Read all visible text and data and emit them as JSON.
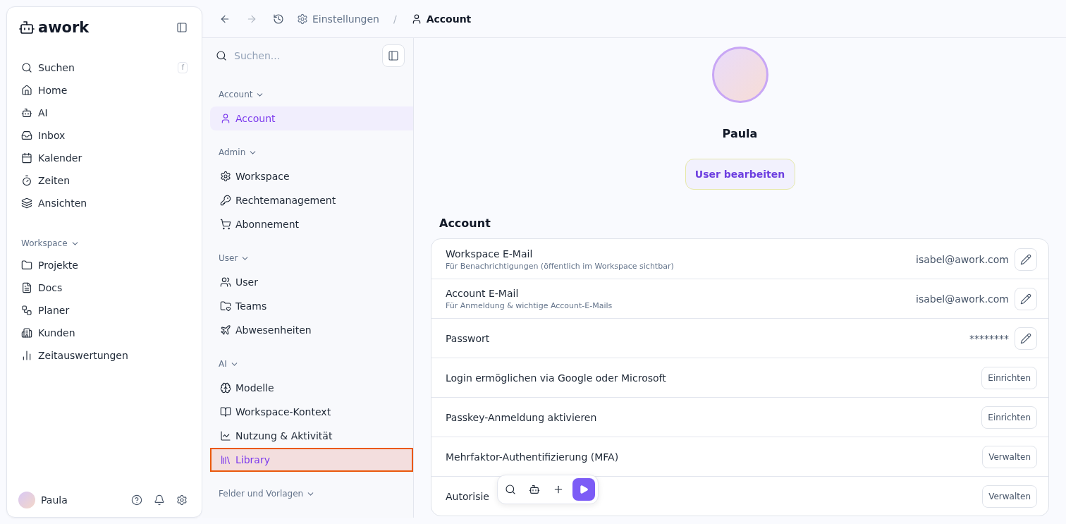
{
  "sidebar": {
    "logo": "awork",
    "search": {
      "label": "Suchen",
      "shortcut": "f"
    },
    "items": [
      {
        "label": "Home"
      },
      {
        "label": "AI"
      },
      {
        "label": "Inbox"
      },
      {
        "label": "Kalender"
      },
      {
        "label": "Zeiten"
      },
      {
        "label": "Ansichten"
      }
    ],
    "workspace": {
      "title": "Workspace",
      "expanded": true,
      "items": [
        {
          "label": "Projekte"
        },
        {
          "label": "Docs"
        },
        {
          "label": "Planer"
        },
        {
          "label": "Kunden"
        },
        {
          "label": "Zeitauswertungen"
        }
      ]
    },
    "user": {
      "name": "Paula"
    }
  },
  "breadcrumb_separator": "/",
  "breadcrumb": [
    {
      "label": "Einstellungen",
      "current": false
    },
    {
      "label": "Account",
      "current": true
    }
  ],
  "settings_nav": {
    "search": {
      "placeholder": "Suchen..."
    },
    "groups": [
      {
        "title": "Account",
        "items": [
          {
            "label": "Account",
            "selected": true,
            "highlighted": false
          }
        ]
      },
      {
        "title": "Admin",
        "items": [
          {
            "label": "Workspace",
            "selected": false,
            "highlighted": false
          },
          {
            "label": "Rechtemanagement",
            "selected": false,
            "highlighted": false
          },
          {
            "label": "Abonnement",
            "selected": false,
            "highlighted": false
          }
        ]
      },
      {
        "title": "User",
        "items": [
          {
            "label": "User",
            "selected": false,
            "highlighted": false
          },
          {
            "label": "Teams",
            "selected": false,
            "highlighted": false
          },
          {
            "label": "Abwesenheiten",
            "selected": false,
            "highlighted": false
          }
        ]
      },
      {
        "title": "AI",
        "items": [
          {
            "label": "Modelle",
            "selected": false,
            "highlighted": false
          },
          {
            "label": "Workspace-Kontext",
            "selected": false,
            "highlighted": false
          },
          {
            "label": "Nutzung & Aktivität",
            "selected": false,
            "highlighted": false
          },
          {
            "label": "Library",
            "selected": false,
            "highlighted": true
          }
        ]
      },
      {
        "title": "Felder und Vorlagen"
      }
    ]
  },
  "profile": {
    "name": "Paula",
    "edit_button": "User bearbeiten"
  },
  "account": {
    "title": "Account",
    "rows": [
      {
        "kind": "edit",
        "label": "Workspace E-Mail",
        "description": "Für Benachrichtigungen (öffentlich im Workspace sichtbar)",
        "value": "isabel@awork.com"
      },
      {
        "kind": "edit",
        "label": "Account E-Mail",
        "description": "Für Anmeldung & wichtige Account-E-Mails",
        "value": "isabel@awork.com"
      },
      {
        "kind": "edit",
        "label": "Passwort",
        "value": "********"
      },
      {
        "kind": "action",
        "label": "Login ermöglichen via Google oder Microsoft",
        "button": "Einrichten"
      },
      {
        "kind": "action",
        "label": "Passkey-Anmeldung aktivieren",
        "button": "Einrichten"
      },
      {
        "kind": "action",
        "label": "Mehrfaktor-Authentifizierung (MFA)",
        "button": "Verwalten"
      },
      {
        "kind": "action",
        "label": "Autorisie",
        "button": "Verwalten"
      }
    ]
  }
}
